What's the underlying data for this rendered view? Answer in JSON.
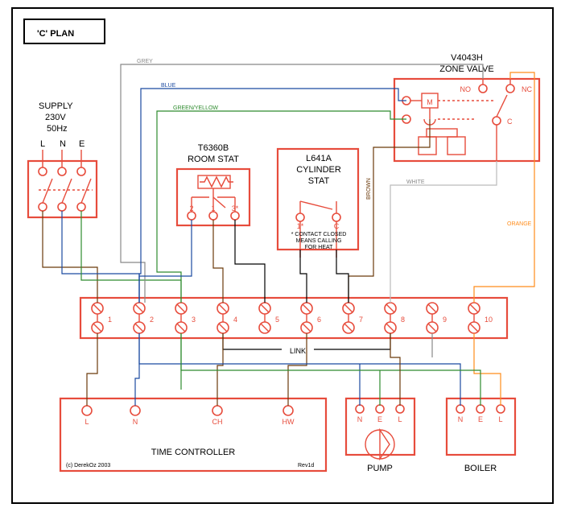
{
  "title": "'C' PLAN",
  "supply": {
    "label": "SUPPLY",
    "voltage": "230V",
    "freq": "50Hz",
    "L": "L",
    "N": "N",
    "E": "E"
  },
  "roomstat": {
    "model": "T6360B",
    "label": "ROOM STAT",
    "t1": "1",
    "t2": "2",
    "t3": "3*"
  },
  "cylstat": {
    "model": "L641A",
    "label1": "CYLINDER",
    "label2": "STAT",
    "t1": "1*",
    "tc": "C",
    "note1": "* CONTACT CLOSED",
    "note2": "MEANS CALLING",
    "note3": "FOR HEAT"
  },
  "zonevalve": {
    "model": "V4043H",
    "label": "ZONE VALVE",
    "M": "M",
    "NO": "NO",
    "NC": "NC",
    "C": "C"
  },
  "junction": {
    "t": [
      "1",
      "2",
      "3",
      "4",
      "5",
      "6",
      "7",
      "8",
      "9",
      "10"
    ],
    "link": "LINK"
  },
  "timecontroller": {
    "label": "TIME CONTROLLER",
    "L": "L",
    "N": "N",
    "CH": "CH",
    "HW": "HW",
    "copyright": "(c) DerekOz 2003",
    "rev": "Rev1d"
  },
  "pump": {
    "label": "PUMP",
    "N": "N",
    "E": "E",
    "L": "L"
  },
  "boiler": {
    "label": "BOILER",
    "N": "N",
    "E": "E",
    "L": "L"
  },
  "wirecolors": {
    "grey": "GREY",
    "blue": "BLUE",
    "gny": "GREEN/YELLOW",
    "brown": "BROWN",
    "white": "WHITE",
    "orange": "ORANGE"
  }
}
